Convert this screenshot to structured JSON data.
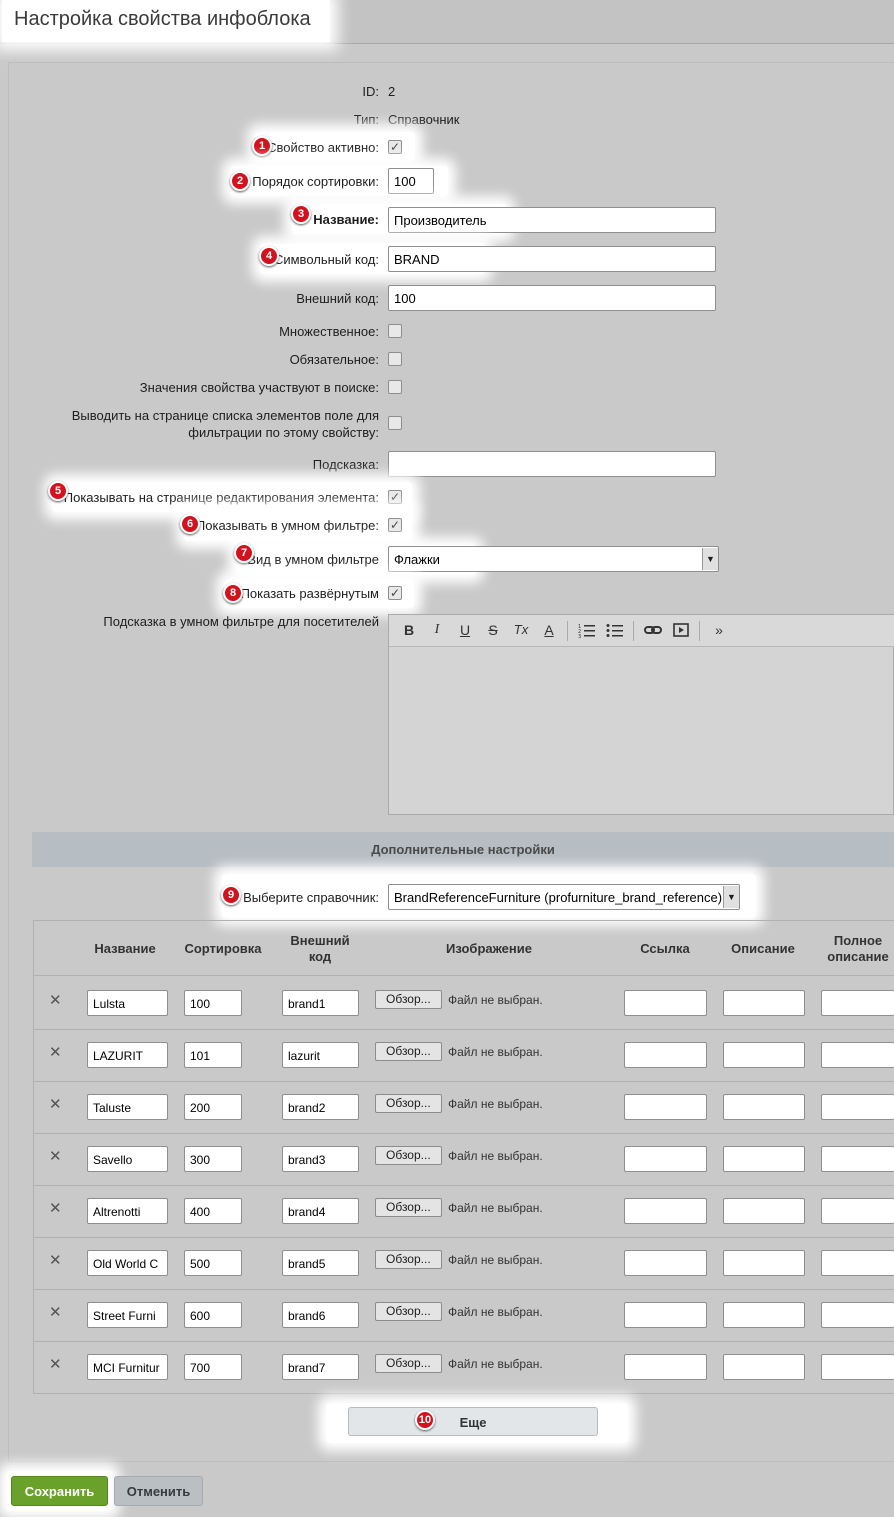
{
  "header": {
    "title": "Настройка свойства инфоблока"
  },
  "fields": {
    "id": {
      "label": "ID:",
      "value": "2"
    },
    "type": {
      "label": "Тип:",
      "value": "Справочник"
    },
    "active": {
      "label": "Свойство активно:",
      "checked": true
    },
    "sort": {
      "label": "Порядок сортировки:",
      "value": "100"
    },
    "name": {
      "label": "Название:",
      "value": "Производитель"
    },
    "code": {
      "label": "Символьный код:",
      "value": "BRAND"
    },
    "xml_id": {
      "label": "Внешний код:",
      "value": "100"
    },
    "multiple": {
      "label": "Множественное:",
      "checked": false
    },
    "required": {
      "label": "Обязательное:",
      "checked": false
    },
    "searchable": {
      "label": "Значения свойства участвуют в поиске:",
      "checked": false
    },
    "filtrable_line1": "Выводить на странице списка элементов поле для",
    "filtrable_line2": "фильтрации по этому свойству:",
    "hint": {
      "label": "Подсказка:",
      "value": ""
    },
    "show_edit": {
      "label": "Показывать на странице редактирования элемента:",
      "checked": true
    },
    "smart_filter": {
      "label": "Показывать в умном фильтре:",
      "checked": true
    },
    "smart_view": {
      "label": "Вид в умном фильтре",
      "value": "Флажки"
    },
    "expanded": {
      "label": "Показать развёрнутым",
      "checked": true
    },
    "visitor_hint": {
      "label": "Подсказка в умном фильтре для посетителей"
    }
  },
  "editor": {
    "bold": "B",
    "italic": "I",
    "underline": "U",
    "strike": "S",
    "clear": "Tx",
    "color": "A",
    "more": "»"
  },
  "extra": {
    "section_title": "Дополнительные настройки",
    "ref_label": "Выберите справочник:",
    "ref_value": "BrandReferenceFurniture (profurniture_brand_reference)"
  },
  "table": {
    "headers": {
      "name": "Название",
      "sort": "Сортировка",
      "xml1": "Внешний",
      "xml2": "код",
      "image": "Изображение",
      "link": "Ссылка",
      "desc": "Описание",
      "full1": "Полное",
      "full2": "описание"
    },
    "browse": "Обзор...",
    "nofile": "Файл не выбран.",
    "rows": [
      {
        "name": "Lulsta",
        "sort": "100",
        "xml": "brand1"
      },
      {
        "name": "LAZURIT",
        "sort": "101",
        "xml": "lazurit"
      },
      {
        "name": "Taluste",
        "sort": "200",
        "xml": "brand2"
      },
      {
        "name": "Savello",
        "sort": "300",
        "xml": "brand3"
      },
      {
        "name": "Altrenotti",
        "sort": "400",
        "xml": "brand4"
      },
      {
        "name": "Old World C",
        "sort": "500",
        "xml": "brand5"
      },
      {
        "name": "Street Furni",
        "sort": "600",
        "xml": "brand6"
      },
      {
        "name": "MCI Furnitur",
        "sort": "700",
        "xml": "brand7"
      }
    ]
  },
  "more_button": "Еще",
  "footer": {
    "save": "Сохранить",
    "cancel": "Отменить"
  },
  "badges": [
    "1",
    "2",
    "3",
    "4",
    "5",
    "6",
    "7",
    "8",
    "9",
    "10"
  ],
  "colors": {
    "badge": "#d4121e",
    "save": "#6aa12a"
  }
}
